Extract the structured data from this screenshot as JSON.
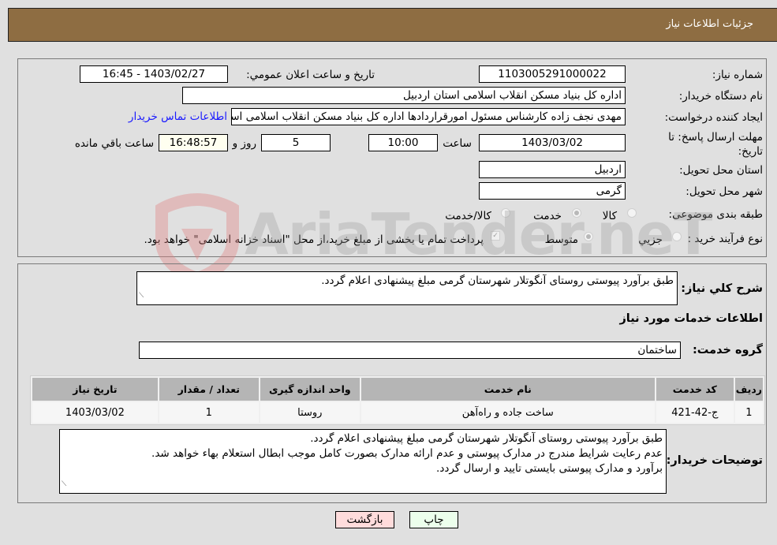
{
  "header": {
    "title": "جزئیات اطلاعات نیاز"
  },
  "form": {
    "need_number": {
      "label": "شماره نیاز:",
      "value": "1103005291000022"
    },
    "announce_datetime": {
      "label": "تاریخ و ساعت اعلان عمومي:",
      "value": "1403/02/27 - 16:45"
    },
    "buyer_org": {
      "label": "نام دستگاه خریدار:",
      "value": "اداره کل بنیاد مسکن انقلاب اسلامی استان اردبیل"
    },
    "requester": {
      "label": "ایجاد کننده درخواست:",
      "value": "مهدی نجف زاده کارشناس مسئول امورقراردادها اداره کل بنیاد مسکن انقلاب اسلامی استان اردبیل"
    },
    "buyer_contact_link": "اطلاعات تماس خریدار",
    "deadline": {
      "label": "مهلت ارسال پاسخ: تا تاریخ:",
      "date": "1403/03/02",
      "time_label": "ساعت",
      "time": "10:00",
      "days": "5",
      "days_label": "روز و",
      "remaining": "16:48:57",
      "remaining_label": "ساعت باقي مانده"
    },
    "province": {
      "label": "استان محل تحویل:",
      "value": "اردبیل"
    },
    "city": {
      "label": "شهر محل تحویل:",
      "value": "گرمی"
    },
    "category": {
      "label": "طبقه بندی موضوعی:",
      "options": [
        {
          "label": "کالا",
          "selected": false
        },
        {
          "label": "خدمت",
          "selected": true
        },
        {
          "label": "کالا/خدمت",
          "selected": false
        }
      ]
    },
    "purchase_type": {
      "label": "نوع فرآیند خرید :",
      "options": [
        {
          "label": "جزيي",
          "selected": false
        },
        {
          "label": "متوسط",
          "selected": true
        }
      ],
      "treasury_checkbox": {
        "checked": true,
        "label": "پرداخت تمام یا بخشی از مبلغ خرید،از محل \"اسناد خزانه اسلامی\" خواهد بود."
      }
    }
  },
  "details": {
    "general_desc_label": "شرح کلي نیاز:",
    "general_desc": "طبق برآورد پیوستی روستای آنگوتلار شهرستان گرمی مبلغ پیشنهادی اعلام گردد.",
    "services_title": "اطلاعات خدمات مورد نیاز",
    "service_group_label": "گروه خدمت:",
    "service_group": "ساختمان",
    "table": {
      "headers": [
        "ردیف",
        "کد خدمت",
        "نام خدمت",
        "واحد اندازه گیری",
        "تعداد / مقدار",
        "تاریخ نیاز"
      ],
      "rows": [
        [
          "1",
          "ج-42-421",
          "ساخت جاده و راه‌آهن",
          "روستا",
          "1",
          "1403/03/02"
        ]
      ]
    },
    "buyer_notes_label": "توضیحات خریدار:",
    "buyer_notes": [
      "طبق برآورد پیوستی روستای آنگوتلار شهرستان گرمی مبلغ پیشنهادی اعلام گردد.",
      "عدم رعایت شرایط مندرج در مدارک پیوستی و عدم ارائه مدارک بصورت کامل موجب ابطال استعلام بهاء خواهد شد.",
      "برآورد و مدارک پیوستی بایستی تایید و ارسال گردد."
    ]
  },
  "buttons": {
    "print": "چاپ",
    "back": "بازگشت"
  },
  "watermark": "AriaTender.neT",
  "colors": {
    "header_bg": "#8e6d42",
    "link": "#1a1aff",
    "back_btn": "#ffdcdc",
    "print_btn": "#ecffec"
  }
}
